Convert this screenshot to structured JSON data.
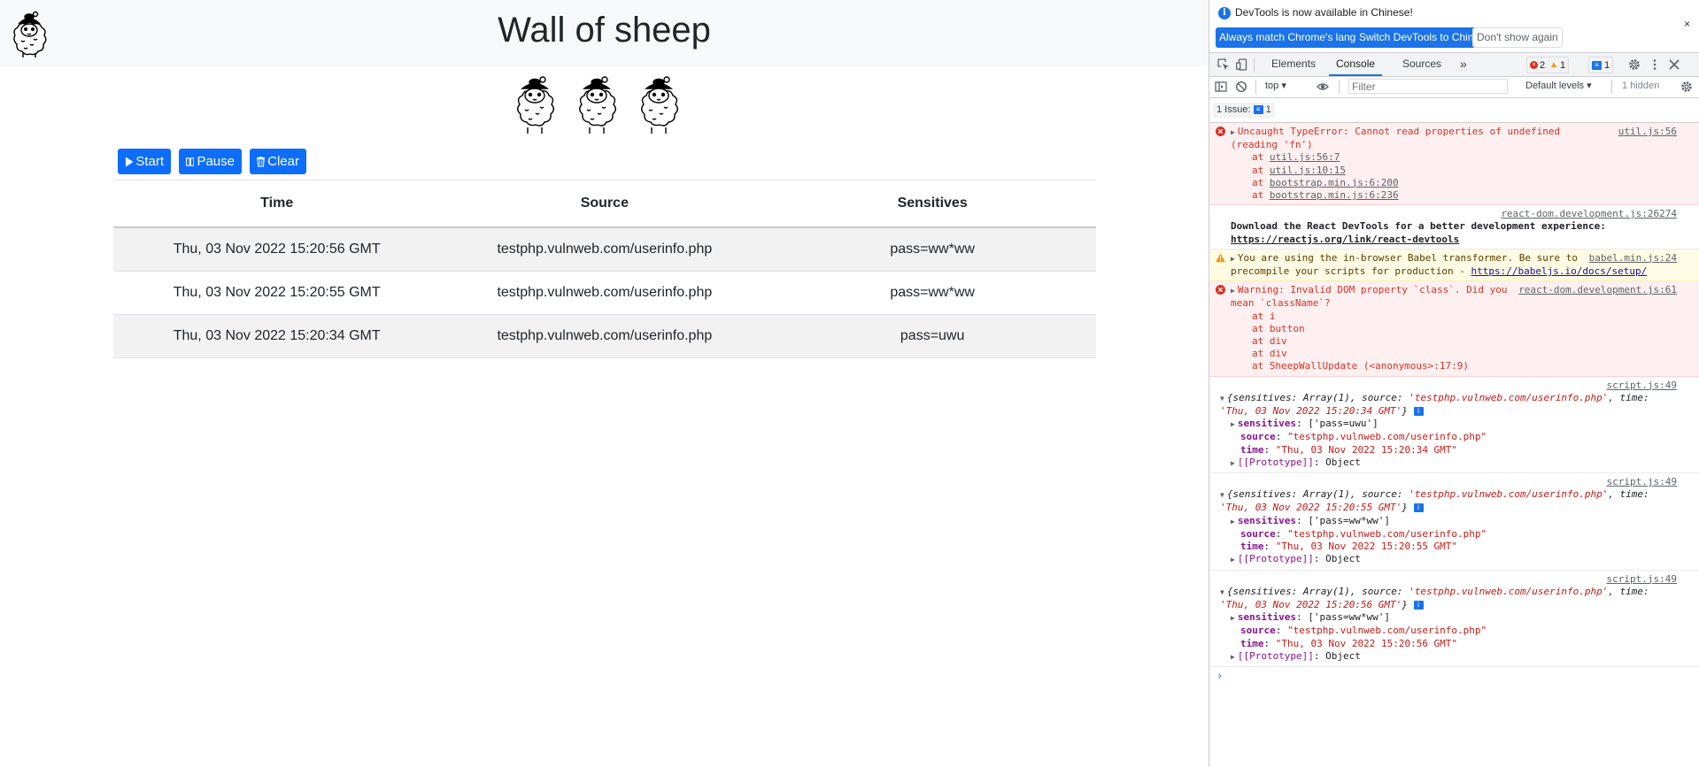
{
  "page": {
    "title": "Wall of sheep",
    "buttons": {
      "start": "Start",
      "pause": "Pause",
      "clear": "Clear"
    },
    "table": {
      "headers": [
        "Time",
        "Source",
        "Sensitives"
      ],
      "rows": [
        [
          "Thu, 03 Nov 2022 15:20:56 GMT",
          "testphp.vulnweb.com/userinfo.php",
          "pass=ww*ww"
        ],
        [
          "Thu, 03 Nov 2022 15:20:55 GMT",
          "testphp.vulnweb.com/userinfo.php",
          "pass=ww*ww"
        ],
        [
          "Thu, 03 Nov 2022 15:20:34 GMT",
          "testphp.vulnweb.com/userinfo.php",
          "pass=uwu"
        ]
      ]
    },
    "colors": {
      "primary": "#0d6efd",
      "navbar": "#f8f9fa",
      "striped_row": "#f2f2f2"
    }
  },
  "devtools": {
    "infobar": {
      "text": "DevTools is now available in Chinese!",
      "btn_match": "Always match Chrome's language",
      "btn_switch": "Switch DevTools to Chinese",
      "btn_dont_show": "Don't show again",
      "close": "×"
    },
    "tabs": [
      "Elements",
      "Console",
      "Sources",
      "»"
    ],
    "active_tab": "Console",
    "counts": {
      "errors": "2",
      "warnings": "1",
      "messages": "1"
    },
    "toolbar": {
      "context": "top ▾",
      "filter_placeholder": "Filter",
      "levels": "Default levels ▾",
      "hidden": "1 hidden"
    },
    "issues": {
      "label": "1 Issue:",
      "count": "1"
    },
    "messages": {
      "m1": {
        "text": "Uncaught TypeError: Cannot read properties of undefined (reading 'fn')",
        "source": "util.js:56",
        "stack": [
          {
            "at": "at ",
            "loc": "util.js:56:7"
          },
          {
            "at": "at ",
            "loc": "util.js:10:15"
          },
          {
            "at": "at ",
            "loc": "bootstrap.min.js:6:200"
          },
          {
            "at": "at ",
            "loc": "bootstrap.min.js:6:236"
          }
        ]
      },
      "m2": {
        "source": "react-dom.development.js:26274",
        "text": "Download the React DevTools for a better development experience: ",
        "link": "https://reactjs.org/link/react-devtools"
      },
      "m3": {
        "text": "You are using the in-browser Babel transformer. Be sure to precompile your scripts for production - ",
        "link": "https://babeljs.io/docs/setup/",
        "source": "babel.min.js:24"
      },
      "m4": {
        "text": "Warning: Invalid DOM property `class`. Did you mean `className`?",
        "source": "react-dom.development.js:61",
        "stack": [
          "at i",
          "at button",
          "at div",
          "at div",
          "at SheepWallUpdate (<anonymous>:17:9)"
        ]
      },
      "logs": [
        {
          "source": "script.js:49",
          "summary_a": "{sensitives: Array(1), source: ",
          "summary_src": "'testphp.vulnweb.com/userinfo.php'",
          "summary_b": ", time: ",
          "summary_time": "'Thu, 03 Nov 2022 15:20:34 GMT'",
          "summary_c": "}",
          "sensitives": "['pass=uwu']",
          "src": "\"testphp.vulnweb.com/userinfo.php\"",
          "time": "\"Thu, 03 Nov 2022 15:20:34 GMT\""
        },
        {
          "source": "script.js:49",
          "summary_a": "{sensitives: Array(1), source: ",
          "summary_src": "'testphp.vulnweb.com/userinfo.php'",
          "summary_b": ", time: ",
          "summary_time": "'Thu, 03 Nov 2022 15:20:55 GMT'",
          "summary_c": "}",
          "sensitives": "['pass=ww*ww']",
          "src": "\"testphp.vulnweb.com/userinfo.php\"",
          "time": "\"Thu, 03 Nov 2022 15:20:55 GMT\""
        },
        {
          "source": "script.js:49",
          "summary_a": "{sensitives: Array(1), source: ",
          "summary_src": "'testphp.vulnweb.com/userinfo.php'",
          "summary_b": ", time: ",
          "summary_time": "'Thu, 03 Nov 2022 15:20:56 GMT'",
          "summary_c": "}",
          "sensitives": "['pass=ww*ww']",
          "src": "\"testphp.vulnweb.com/userinfo.php\"",
          "time": "\"Thu, 03 Nov 2022 15:20:56 GMT\""
        }
      ],
      "keys": {
        "sensitives": "sensitives",
        "source": "source",
        "time": "time",
        "proto": "[[Prototype]]",
        "object": "Object"
      }
    },
    "colors": {
      "accent": "#1a73e8",
      "error_bg": "#fef0f0",
      "warn_bg": "#fffbe5",
      "error_text": "#d93025"
    }
  }
}
